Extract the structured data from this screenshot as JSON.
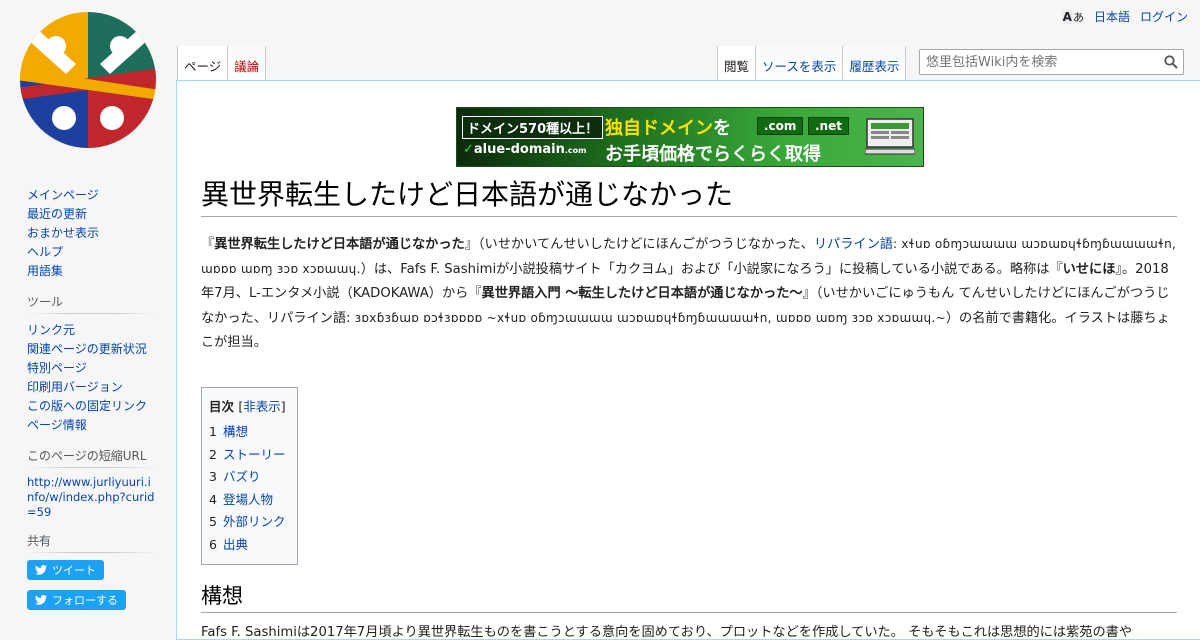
{
  "personal": {
    "language_glyph_a": "A",
    "language_glyph_b": "あ",
    "language": "日本語",
    "login": "ログイン"
  },
  "tabs": {
    "page": "ページ",
    "talk": "議論",
    "read": "閲覧",
    "view_source": "ソースを表示",
    "history": "履歴表示"
  },
  "search": {
    "placeholder": "悠里包括Wiki内を検索"
  },
  "sidebar": {
    "navigation": [
      "メインページ",
      "最近の更新",
      "おまかせ表示",
      "ヘルプ",
      "用語集"
    ],
    "tools_heading": "ツール",
    "tools": [
      "リンク元",
      "関連ページの更新状況",
      "特別ページ",
      "印刷用バージョン",
      "この版への固定リンク",
      "ページ情報"
    ],
    "shorturl_heading": "このページの短縮URL",
    "shorturl": "http://www.jurliyuuri.info/w/index.php?curid=59",
    "share_heading": "共有",
    "tweet": "ツイート",
    "follow": "フォローする"
  },
  "banner": {
    "badge_prefix": "ドメイン",
    "badge_number": "570",
    "badge_suffix": "種以上！",
    "logo": "alue-domain",
    "logo_check": "✓",
    "logo_tld": ".com",
    "line1_a": "独自ドメイン",
    "line1_b": "を",
    "line2": "お手頃価格でらくらく取得",
    "tld1": ".com",
    "tld2": ".net"
  },
  "article": {
    "title": "異世界転生したけど日本語が通じなかった",
    "intro": {
      "open_quote": "『",
      "bold_title": "異世界転生したけど日本語が通じなかった",
      "close_reading_1": "』（いせかいてんせいしたけどにほんごがつうじなかった、",
      "link_ripaine": "リパライン語",
      "conscript_1": ": xɬuɒ oɓɱɔɯɯɯɯ ɯɔɒɯɒɥɬɓɱɓɯɯɯɯɬn, ɯɒɒɒ ɯɒɱ ɜɔɒ xɔɒɯɯɥ.",
      "after_1": "）は、Fafs F. Sashimiが小説投稿サイト「カクヨム」および「小説家になろう」に投稿している小説である。略称は『",
      "bold_short": "いせにほ",
      "after_2": "』。2018年7月、L-エンタメ小説（KADOKAWA）から『",
      "bold_book": "異世界語入門 〜転生したけど日本語が通じなかった〜",
      "after_3": "』（いせかいごにゅうもん てんせいしたけどにほんごがつうじなかった、リパライン語: ",
      "conscript_2": "ɜɒxɓɜɓɯɒ ɒɔɬɜɒɒɒɒ ~xɬuɒ oɓɱɔɯɯɯɯ ɯɔɒɯɒɥɬɓɱɓɯɯɯɯɬn, ɯɒɒɒ ɯɒɱ ɜɔɒ xɔɒɯɯɥ.~",
      "after_4": "）の名前で書籍化。イラストは藤ちょこが担当。"
    },
    "toc": {
      "title": "目次",
      "toggle_open": "[",
      "toggle": "非表示",
      "toggle_close": "]",
      "items": [
        {
          "num": "1",
          "label": "構想"
        },
        {
          "num": "2",
          "label": "ストーリー"
        },
        {
          "num": "3",
          "label": "バズり"
        },
        {
          "num": "4",
          "label": "登場人物"
        },
        {
          "num": "5",
          "label": "外部リンク"
        },
        {
          "num": "6",
          "label": "出典"
        }
      ]
    },
    "section1_title": "構想",
    "section1_text": "Fafs F. Sashimiは2017年7月頃より異世界転生ものを書こうとする意向を固めており、プロットなどを作成していた。 そもそもこれは思想的には紫苑の書や"
  },
  "colors": {
    "link": "#0645ad",
    "new_link": "#ba0000",
    "border": "#a7d7f9",
    "twitter": "#1da1f2",
    "banner_green": "#39a839",
    "banner_yellow": "#ffe100"
  }
}
